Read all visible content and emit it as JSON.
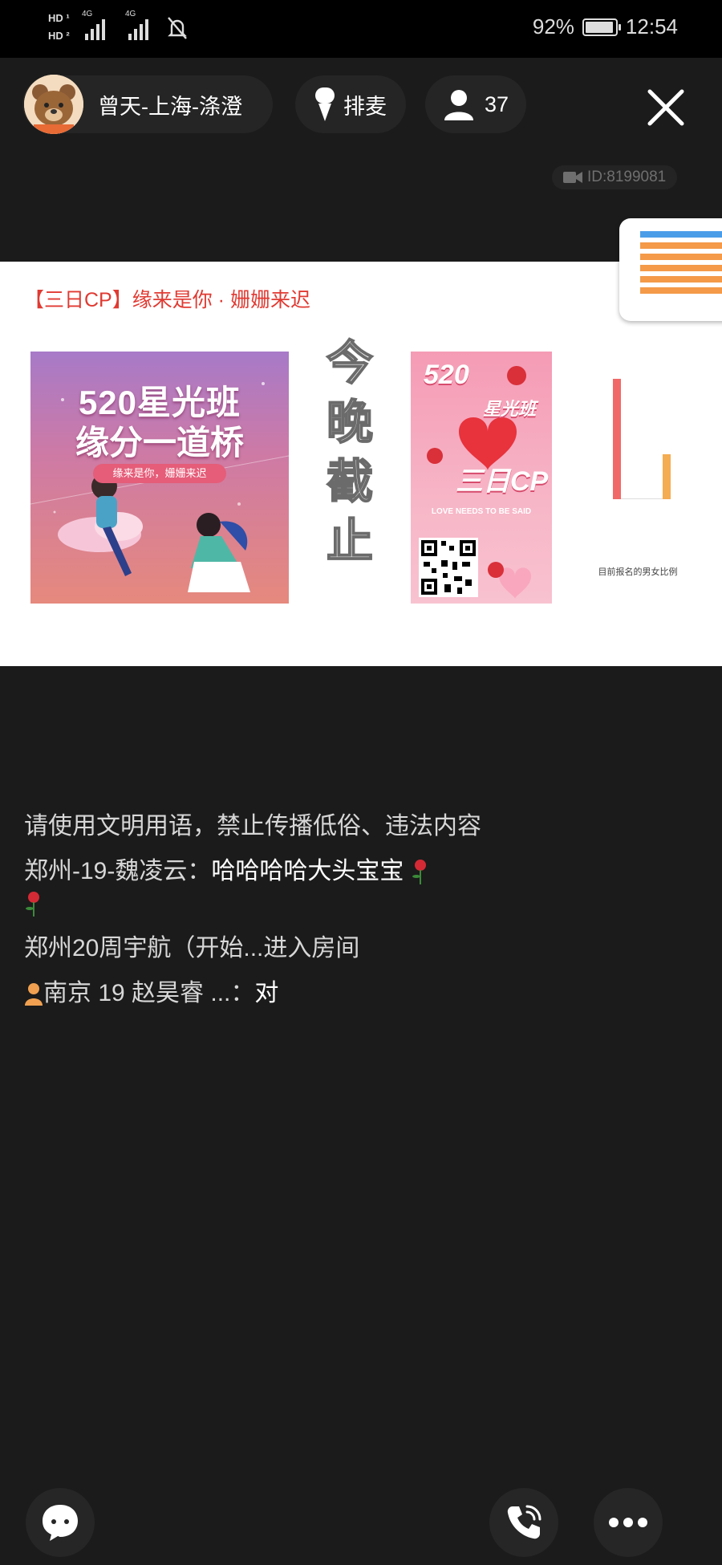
{
  "status_bar": {
    "hd1": "HD",
    "hd2": "HD",
    "net1": "4G",
    "net2": "4G",
    "battery": "92%",
    "time": "12:54"
  },
  "header": {
    "host_name": "曾天-上海-涤澄",
    "queue_label": "排麦",
    "online_count": "37",
    "room_id": "ID:8199081"
  },
  "banner": {
    "title": "【三日CP】缘来是你 · 姗姗来迟",
    "poster1_line1": "520星光班",
    "poster1_line2": "缘分一道桥",
    "poster1_sub": "缘来是你，姗姗来迟",
    "vertical_text": [
      "今",
      "晚",
      "截",
      "止"
    ],
    "poster2_520": "520",
    "poster2_sub": "星光班",
    "poster2_cp": "三日CP",
    "poster2_love": "LOVE NEEDS TO BE SAID",
    "chart_caption": "目前报名的男女比例"
  },
  "chat": {
    "notice": "请使用文明用语，禁止传播低俗、违法内容",
    "messages": [
      {
        "user": "郑州-19-魏凌云：",
        "text": "哈哈哈哈大头宝宝"
      },
      {
        "user": "郑州20周宇航（开始...",
        "text": "进入房间"
      },
      {
        "user": "南京 19 赵昊睿 ...：",
        "text": "对"
      }
    ]
  },
  "colors": {
    "background": "#1b1b1b",
    "banner_title": "#e03a32",
    "bar_red": "#f06968",
    "bar_yellow": "#f4ad52"
  },
  "icons": [
    "signal-icon",
    "mute-bell-icon",
    "battery-icon",
    "microphone-icon",
    "user-icon",
    "close-icon",
    "video-icon",
    "chat-bubble-icon",
    "phone-icon",
    "more-icon"
  ]
}
